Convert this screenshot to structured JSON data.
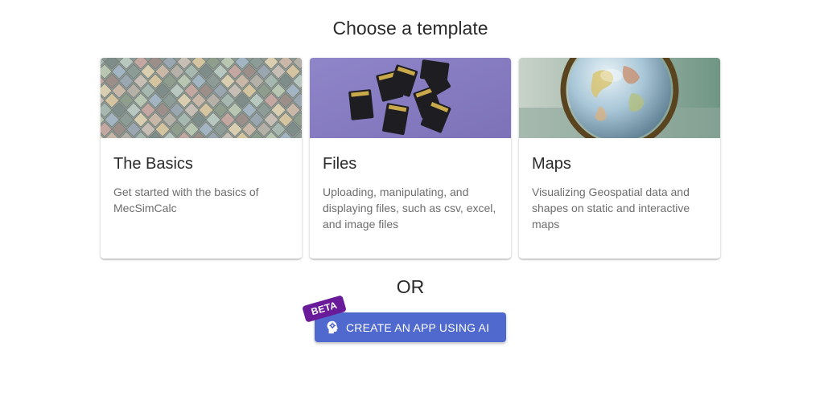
{
  "header": {
    "title": "Choose a template"
  },
  "templates": [
    {
      "title": "The Basics",
      "description": "Get started with the basics of MecSimCalc",
      "image": "colorful-shingles-image"
    },
    {
      "title": "Files",
      "description": "Uploading, manipulating, and displaying files, such as csv, excel, and image files",
      "image": "sd-cards-image"
    },
    {
      "title": "Maps",
      "description": "Visualizing Geospatial data and shapes on static and interactive maps",
      "image": "globe-image"
    }
  ],
  "divider": {
    "text": "OR"
  },
  "ai_button": {
    "label": "CREATE AN APP USING AI",
    "icon": "lightbulb-head-icon",
    "badge": "BETA"
  },
  "colors": {
    "button": "#5069cf",
    "badge": "#6a1b9a"
  }
}
